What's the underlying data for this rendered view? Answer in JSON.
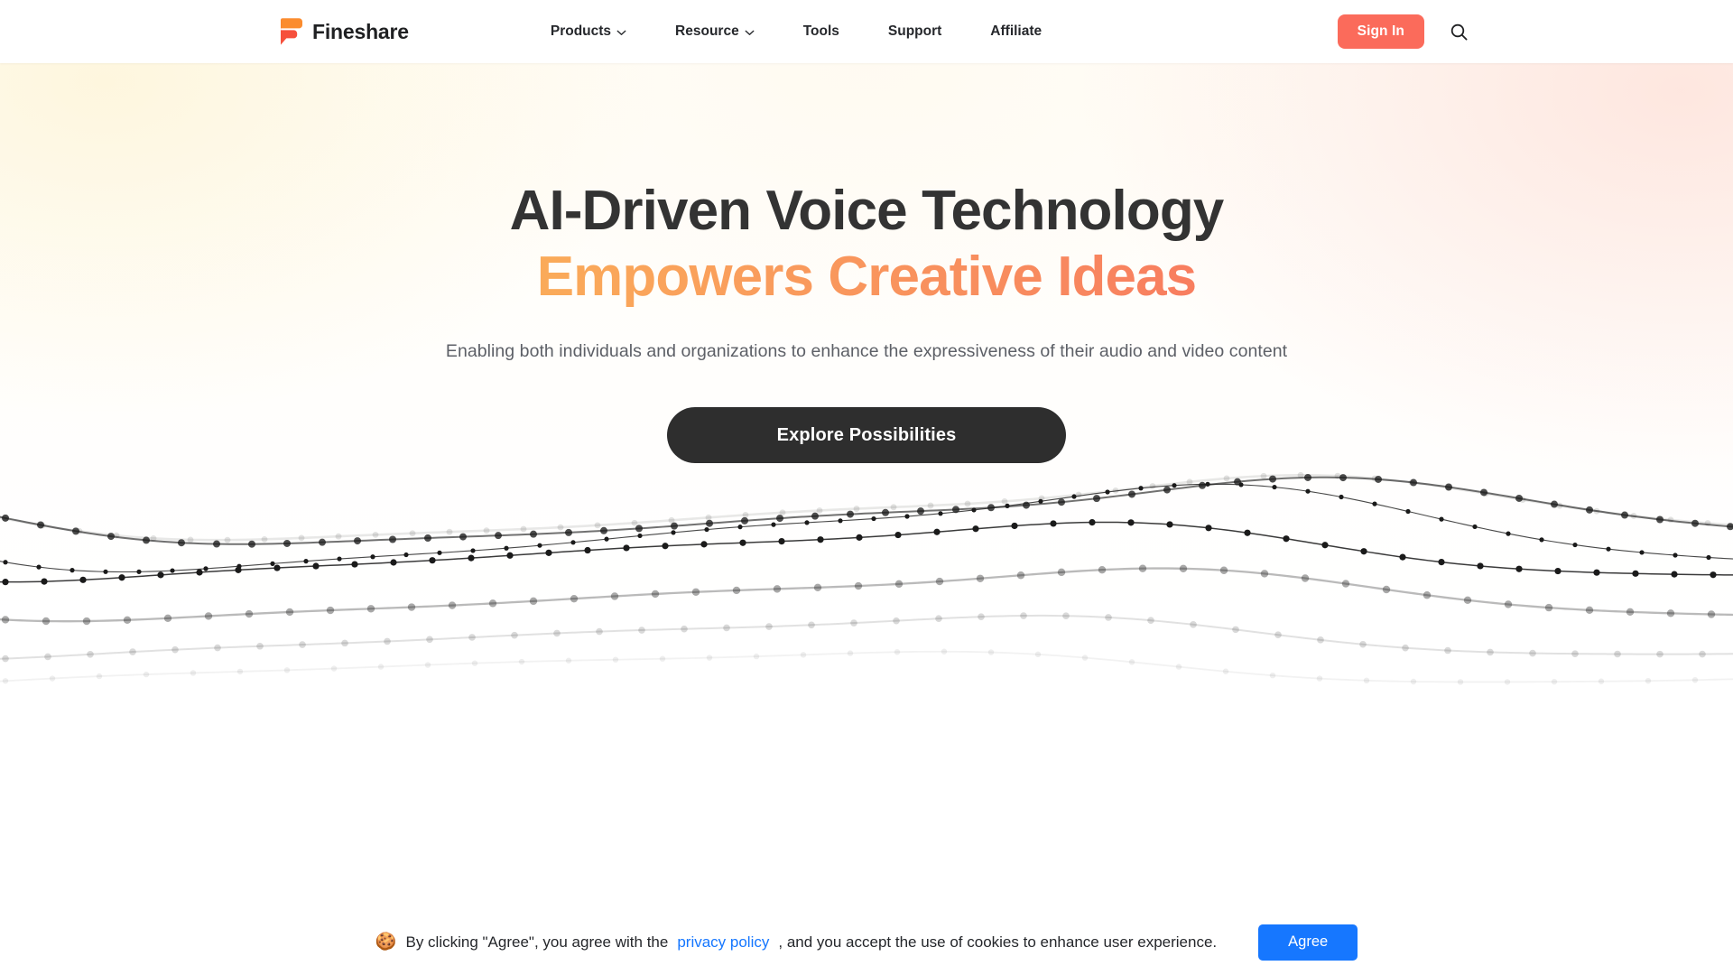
{
  "header": {
    "brand": {
      "name": "Fineshare",
      "mark_icon": "fineshare-logo-icon",
      "mark_color_top": "#FB8C2E",
      "mark_color_bottom": "#F9543F"
    },
    "nav": [
      {
        "label": "Products",
        "has_dropdown": true,
        "icon": "chevron-down-icon"
      },
      {
        "label": "Resource",
        "has_dropdown": true,
        "icon": "chevron-down-icon"
      },
      {
        "label": "Tools",
        "has_dropdown": false,
        "icon": ""
      },
      {
        "label": "Support",
        "has_dropdown": false,
        "icon": ""
      },
      {
        "label": "Affiliate",
        "has_dropdown": false,
        "icon": ""
      }
    ],
    "sign_in_label": "Sign In",
    "sign_in_color": "#FB6B5B",
    "search_icon": "search-icon"
  },
  "hero": {
    "headline_line1": "AI-Driven Voice Technology",
    "headline_line2": "Empowers Creative Ideas",
    "headline_color": "#333333",
    "gradient_start": "#FBC14E",
    "gradient_end": "#F65A5F",
    "subtitle": "Enabling both individuals and organizations to enhance the expressiveness of their audio and video content",
    "cta_label": "Explore Possibilities",
    "cta_color": "#2E2E2E"
  },
  "decoration": {
    "wave_graphic_name": "audio-waveform-node-graphic",
    "wave_line_color": "#1a1a1a"
  },
  "cookie_banner": {
    "emoji": "🍪",
    "text_before": "By clicking \"Agree\", you agree with the",
    "link_label": "privacy policy",
    "text_after": ", and you accept the use of cookies to enhance user experience.",
    "agree_label": "Agree",
    "agree_color": "#1677FF",
    "link_color": "#1677FF"
  }
}
